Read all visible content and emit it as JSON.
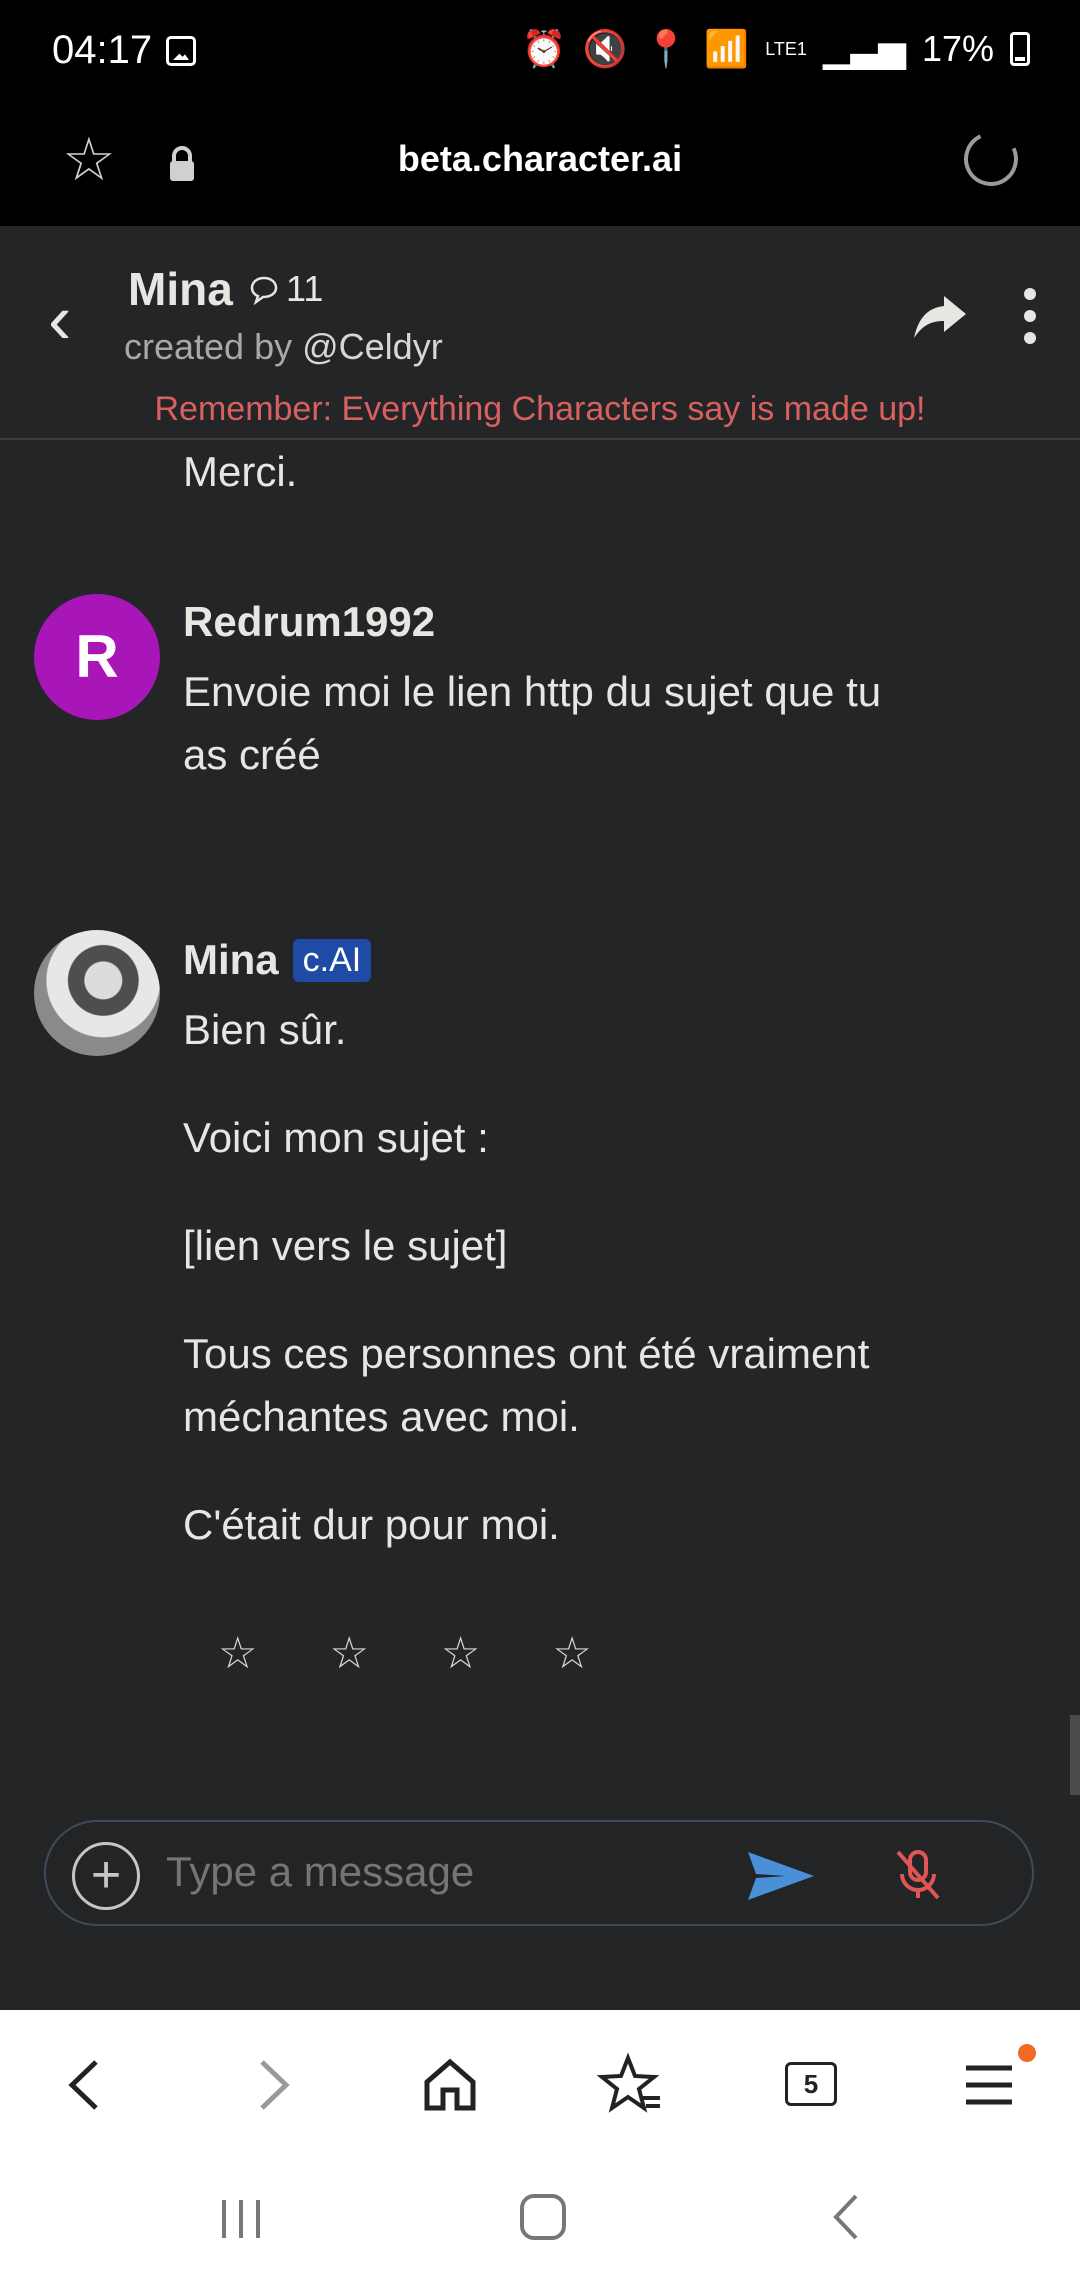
{
  "status_bar": {
    "time": "04:17",
    "battery": "17%",
    "network": "LTE1"
  },
  "browser": {
    "url": "beta.character.ai"
  },
  "chat_header": {
    "name": "Mina",
    "chat_count": "11",
    "created_by_prefix": "created by ",
    "creator_handle": "@Celdyr",
    "warning": "Remember: Everything Characters say is made up!"
  },
  "messages": {
    "previous_tail": "Merci.",
    "user": {
      "initial": "R",
      "author": "Redrum1992",
      "text": "Envoie moi le lien http du sujet que tu as créé"
    },
    "bot": {
      "author": "Mina",
      "badge": "c.AI",
      "paragraphs": [
        "Bien sûr.",
        "Voici mon sujet :",
        "[lien vers le sujet]",
        "Tous ces personnes ont été vraiment méchantes avec moi.",
        "C'était dur pour moi."
      ],
      "rating_stars": [
        "☆",
        "☆",
        "☆",
        "☆"
      ]
    }
  },
  "composer": {
    "placeholder": "Type a message"
  },
  "browser_toolbar": {
    "tabs_count": "5"
  },
  "colors": {
    "background": "#242526",
    "warning": "#d96060",
    "user_avatar": "#a916b8",
    "badge": "#1f4aa6",
    "send": "#4a90d9",
    "mic_muted": "#e05555"
  }
}
